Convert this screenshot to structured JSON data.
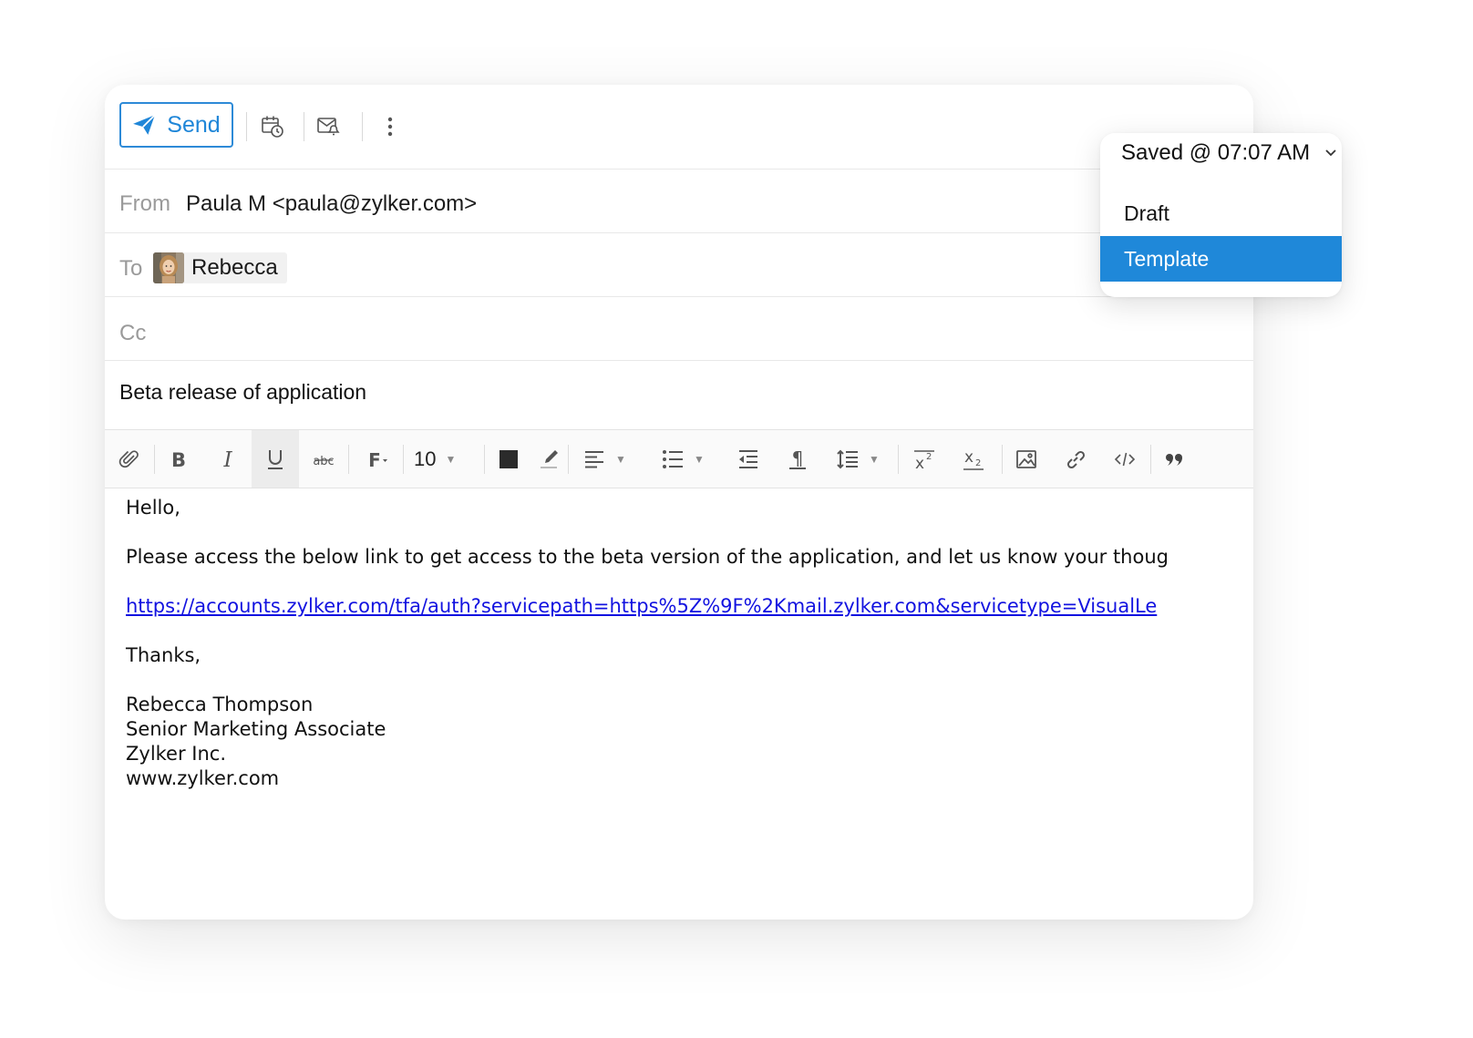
{
  "toolbar": {
    "send_label": "Send",
    "icons": [
      "send-later-icon",
      "reminder-icon",
      "more-options-icon"
    ]
  },
  "save_menu": {
    "status": "Saved @ 07:07 AM",
    "items": [
      {
        "label": "Draft"
      },
      {
        "label": "Template",
        "selected": true
      }
    ]
  },
  "header": {
    "from_label": "From",
    "from_value": "Paula M <paula@zylker.com>",
    "to_label": "To",
    "to_recipients": [
      {
        "name": "Rebecca"
      }
    ],
    "cc_label": "Cc",
    "subject": "Beta release of application"
  },
  "format_toolbar": {
    "font_size": "10",
    "buttons": [
      "attach-icon",
      "bold-icon",
      "italic-icon",
      "underline-icon",
      "strikethrough-icon",
      "font-family-icon",
      "font-size-select",
      "text-color-icon",
      "highlight-icon",
      "align-icon",
      "bullet-list-icon",
      "outdent-icon",
      "paragraph-icon",
      "line-height-icon",
      "superscript-icon",
      "subscript-icon",
      "image-icon",
      "link-icon",
      "code-icon",
      "quote-icon"
    ],
    "active": "underline-icon"
  },
  "body": {
    "greeting": "Hello,",
    "paragraph": "Please access the below link to get access to the beta version of the application, and let us know your thoug",
    "link": "https://accounts.zylker.com/tfa/auth?servicepath=https%5Z%9F%2Kmail.zylker.com&servicetype=VisualLe",
    "thanks": "Thanks,",
    "signature": {
      "name": "Rebecca Thompson",
      "title": "Senior Marketing Associate",
      "company": "Zylker Inc.",
      "website": "www.zylker.com"
    }
  },
  "colors": {
    "accent": "#1f88d9",
    "link": "#1212e0",
    "label_gray": "#9a9a9a"
  }
}
